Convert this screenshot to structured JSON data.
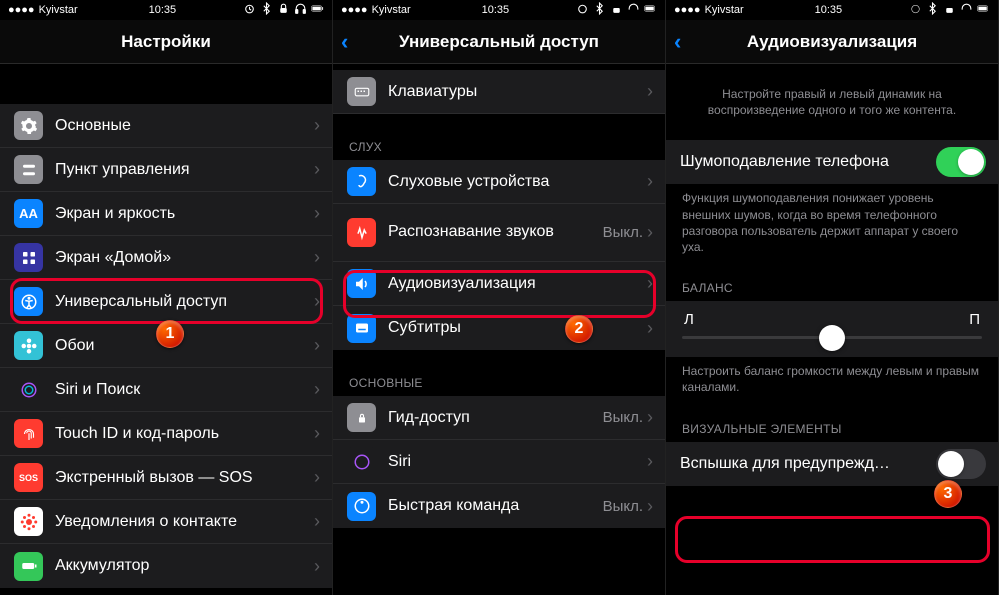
{
  "status": {
    "carrier": "Kyivstar",
    "time": "10:35"
  },
  "panel1": {
    "title": "Настройки",
    "rows": [
      {
        "label": "Основные"
      },
      {
        "label": "Пункт управления"
      },
      {
        "label": "Экран и яркость"
      },
      {
        "label": "Экран «Домой»"
      },
      {
        "label": "Универсальный доступ"
      },
      {
        "label": "Обои"
      },
      {
        "label": "Siri и Поиск"
      },
      {
        "label": "Touch ID и код-пароль"
      },
      {
        "label": "Экстренный вызов — SOS"
      },
      {
        "label": "Уведомления о контакте"
      },
      {
        "label": "Аккумулятор"
      }
    ],
    "badge": "1"
  },
  "panel2": {
    "title": "Универсальный доступ",
    "keyboards": "Клавиатуры",
    "section_hearing": "СЛУХ",
    "rows_hearing": [
      {
        "label": "Слуховые устройства"
      },
      {
        "label": "Распознавание звуков",
        "value": "Выкл."
      },
      {
        "label": "Аудиовизуализация"
      },
      {
        "label": "Субтитры"
      }
    ],
    "section_general": "ОСНОВНЫЕ",
    "rows_general": [
      {
        "label": "Гид-доступ",
        "value": "Выкл."
      },
      {
        "label": "Siri"
      },
      {
        "label": "Быстрая команда",
        "value": "Выкл."
      }
    ],
    "badge": "2"
  },
  "panel3": {
    "title": "Аудиовизуализация",
    "footer1": "Настройте правый и левый динамик на воспроизведение одного и того же контента.",
    "noise_label": "Шумоподавление телефона",
    "footer2": "Функция шумоподавления понижает уровень внешних шумов, когда во время телефонного разговора пользователь держит аппарат у своего уха.",
    "balance_header": "БАЛАНС",
    "balance_left": "Л",
    "balance_right": "П",
    "footer3": "Настроить баланс громкости между левым и правым каналами.",
    "visual_header": "ВИЗУАЛЬНЫЕ ЭЛЕМЕНТЫ",
    "flash_label": "Вспышка для предупрежд…",
    "badge": "3"
  }
}
